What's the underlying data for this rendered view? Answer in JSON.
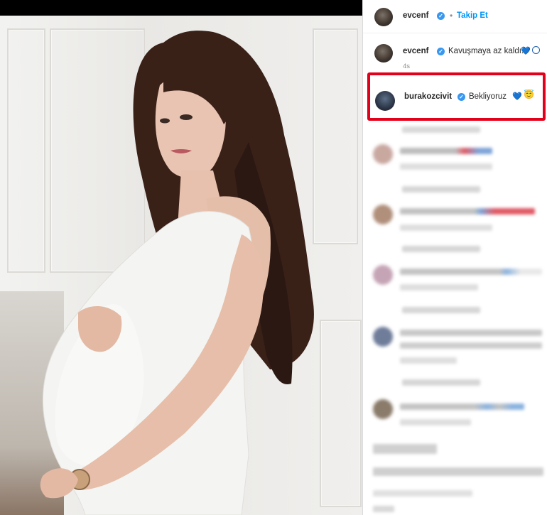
{
  "post": {
    "author": "evcenf",
    "follow_label": "Takip Et",
    "dot": "•",
    "caption_author": "evcenf",
    "caption_text": "Kavuşmaya az kaldı..",
    "caption_time": "4s"
  },
  "highlighted_comment": {
    "author": "burakozcivit",
    "text": "Bekliyoruz"
  },
  "icons": {
    "verified": "verified-badge-icon",
    "heart": "blue-heart-icon",
    "emoji": "angel-face-icon"
  },
  "colors": {
    "highlight_border": "#e3001b",
    "follow": "#0095f6",
    "verified": "#3897f0"
  }
}
